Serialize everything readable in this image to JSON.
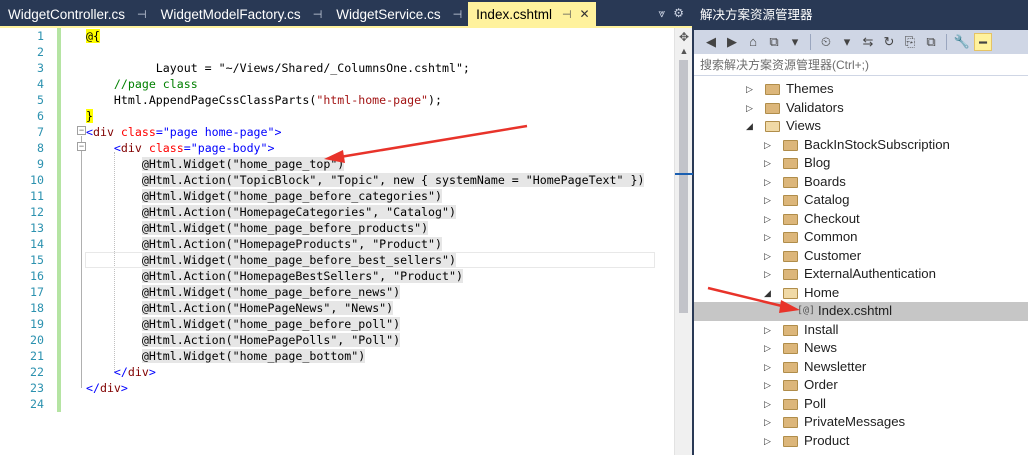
{
  "tabs": [
    {
      "label": "WidgetController.cs",
      "pin": "⊣",
      "active": false
    },
    {
      "label": "WidgetModelFactory.cs",
      "pin": "⊣",
      "active": false
    },
    {
      "label": "WidgetService.cs",
      "pin": "⊣",
      "active": false
    },
    {
      "label": "Index.cshtml",
      "pin": "⊣",
      "active": true
    }
  ],
  "tab_close": "✕",
  "tab_overflow": "⩔",
  "tab_settings": "⚙",
  "line_numbers": [
    "1",
    "2",
    "3",
    "4",
    "5",
    "6",
    "7",
    "8",
    "9",
    "10",
    "11",
    "12",
    "13",
    "14",
    "15",
    "16",
    "17",
    "18",
    "19",
    "20",
    "21",
    "22",
    "23",
    "24"
  ],
  "code": {
    "l1": "@{",
    "l2": "    Layout = \"~/Views/Shared/_ColumnsOne.cshtml\";",
    "l4": "    //page class",
    "l5_a": "    Html.AppendPageCssClassParts(",
    "l5_b": "\"html-home-page\"",
    "l5_c": ");",
    "l6": "}",
    "widgets": [
      {
        "line": 9,
        "call": "@Html.Widget(",
        "args": "\"home_page_top\"",
        "close": ")"
      },
      {
        "line": 10,
        "call": "@Html.Action(",
        "args": "\"TopicBlock\", \"Topic\", new { systemName = \"HomePageText\" }",
        "close": ")"
      },
      {
        "line": 11,
        "call": "@Html.Widget(",
        "args": "\"home_page_before_categories\"",
        "close": ")"
      },
      {
        "line": 12,
        "call": "@Html.Action(",
        "args": "\"HomepageCategories\", \"Catalog\"",
        "close": ")"
      },
      {
        "line": 13,
        "call": "@Html.Widget(",
        "args": "\"home_page_before_products\"",
        "close": ")"
      },
      {
        "line": 14,
        "call": "@Html.Action(",
        "args": "\"HomepageProducts\", \"Product\"",
        "close": ")"
      },
      {
        "line": 15,
        "call": "@Html.Widget(",
        "args": "\"home_page_before_best_sellers\"",
        "close": ")"
      },
      {
        "line": 16,
        "call": "@Html.Action(",
        "args": "\"HomepageBestSellers\", \"Product\"",
        "close": ")"
      },
      {
        "line": 17,
        "call": "@Html.Widget(",
        "args": "\"home_page_before_news\"",
        "close": ")"
      },
      {
        "line": 18,
        "call": "@Html.Action(",
        "args": "\"HomePageNews\", \"News\"",
        "close": ")"
      },
      {
        "line": 19,
        "call": "@Html.Widget(",
        "args": "\"home_page_before_poll\"",
        "close": ")"
      },
      {
        "line": 20,
        "call": "@Html.Action(",
        "args": "\"HomePagePolls\", \"Poll\"",
        "close": ")"
      },
      {
        "line": 21,
        "call": "@Html.Widget(",
        "args": "\"home_page_bottom\"",
        "close": ")"
      }
    ]
  },
  "solution_explorer": {
    "title": "解决方案资源管理器",
    "search_placeholder": "搜索解决方案资源管理器(Ctrl+;)",
    "toolbar_icons": [
      "◀",
      "▶",
      "⌂",
      "⧉",
      "▾",
      "⏲",
      "▾",
      "⇆",
      "↻",
      "⎘",
      "⧉",
      "🔧",
      "━"
    ],
    "items": [
      {
        "label": "Themes",
        "depth": 0,
        "expanded": false
      },
      {
        "label": "Validators",
        "depth": 0,
        "expanded": false
      },
      {
        "label": "Views",
        "depth": 0,
        "expanded": true
      },
      {
        "label": "BackInStockSubscription",
        "depth": 1,
        "expanded": false
      },
      {
        "label": "Blog",
        "depth": 1,
        "expanded": false
      },
      {
        "label": "Boards",
        "depth": 1,
        "expanded": false
      },
      {
        "label": "Catalog",
        "depth": 1,
        "expanded": false
      },
      {
        "label": "Checkout",
        "depth": 1,
        "expanded": false
      },
      {
        "label": "Common",
        "depth": 1,
        "expanded": false
      },
      {
        "label": "Customer",
        "depth": 1,
        "expanded": false
      },
      {
        "label": "ExternalAuthentication",
        "depth": 1,
        "expanded": false
      },
      {
        "label": "Home",
        "depth": 1,
        "expanded": true
      },
      {
        "label": "Index.cshtml",
        "depth": 2,
        "file": true,
        "selected": true
      },
      {
        "label": "Install",
        "depth": 1,
        "expanded": false
      },
      {
        "label": "News",
        "depth": 1,
        "expanded": false
      },
      {
        "label": "Newsletter",
        "depth": 1,
        "expanded": false
      },
      {
        "label": "Order",
        "depth": 1,
        "expanded": false
      },
      {
        "label": "Poll",
        "depth": 1,
        "expanded": false
      },
      {
        "label": "PrivateMessages",
        "depth": 1,
        "expanded": false
      },
      {
        "label": "Product",
        "depth": 1,
        "expanded": false
      }
    ]
  },
  "colors": {
    "accent_arrow": "#e8332a",
    "active_tab": "#fff29d",
    "chrome": "#293955"
  }
}
